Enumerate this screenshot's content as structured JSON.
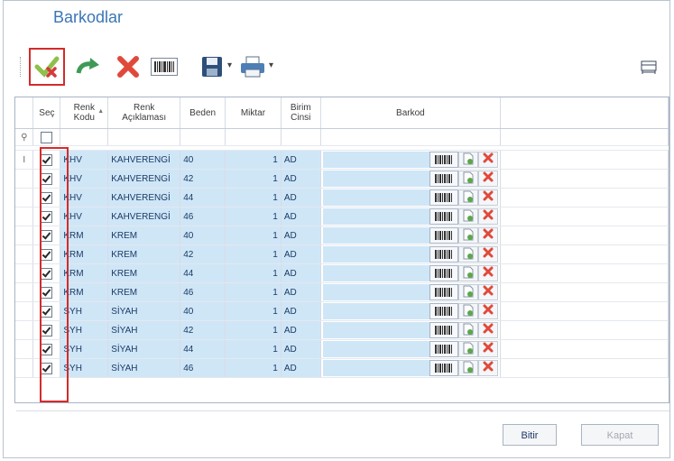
{
  "window": {
    "title": "Barkodlar"
  },
  "toolbar": {
    "items": [
      {
        "name": "approve-icon"
      },
      {
        "name": "redo-arrow-icon"
      },
      {
        "name": "delete-x-icon"
      },
      {
        "name": "barcode-icon"
      },
      {
        "name": "save-dropdown-icon"
      },
      {
        "name": "print-dropdown-icon"
      },
      {
        "name": "column-chooser-icon"
      }
    ]
  },
  "grid": {
    "columns": {
      "sec": "Seç",
      "renk_kodu_1": "Renk",
      "renk_kodu_2": "Kodu",
      "renk_aciklamasi_1": "Renk",
      "renk_aciklamasi_2": "Açıklaması",
      "beden": "Beden",
      "miktar": "Miktar",
      "birim_cinsi_1": "Birim",
      "birim_cinsi_2": "Cinsi",
      "barkod": "Barkod"
    },
    "filter_row_marker": "⚲",
    "edit_row_marker": "I",
    "rows": [
      {
        "kod": "KHV",
        "aciklama": "KAHVERENGİ",
        "beden": "40",
        "miktar": "1",
        "birim": "AD"
      },
      {
        "kod": "KHV",
        "aciklama": "KAHVERENGİ",
        "beden": "42",
        "miktar": "1",
        "birim": "AD"
      },
      {
        "kod": "KHV",
        "aciklama": "KAHVERENGİ",
        "beden": "44",
        "miktar": "1",
        "birim": "AD"
      },
      {
        "kod": "KHV",
        "aciklama": "KAHVERENGİ",
        "beden": "46",
        "miktar": "1",
        "birim": "AD"
      },
      {
        "kod": "KRM",
        "aciklama": "KREM",
        "beden": "40",
        "miktar": "1",
        "birim": "AD"
      },
      {
        "kod": "KRM",
        "aciklama": "KREM",
        "beden": "42",
        "miktar": "1",
        "birim": "AD"
      },
      {
        "kod": "KRM",
        "aciklama": "KREM",
        "beden": "44",
        "miktar": "1",
        "birim": "AD"
      },
      {
        "kod": "KRM",
        "aciklama": "KREM",
        "beden": "46",
        "miktar": "1",
        "birim": "AD"
      },
      {
        "kod": "SYH",
        "aciklama": "SİYAH",
        "beden": "40",
        "miktar": "1",
        "birim": "AD"
      },
      {
        "kod": "SYH",
        "aciklama": "SİYAH",
        "beden": "42",
        "miktar": "1",
        "birim": "AD"
      },
      {
        "kod": "SYH",
        "aciklama": "SİYAH",
        "beden": "44",
        "miktar": "1",
        "birim": "AD"
      },
      {
        "kod": "SYH",
        "aciklama": "SİYAH",
        "beden": "46",
        "miktar": "1",
        "birim": "AD"
      }
    ]
  },
  "footer": {
    "finish_label": "Bitir",
    "close_label": "Kapat"
  },
  "colors": {
    "title": "#3a76b5",
    "highlight": "#d42b2b",
    "row_fill": "#cfe6f7"
  }
}
